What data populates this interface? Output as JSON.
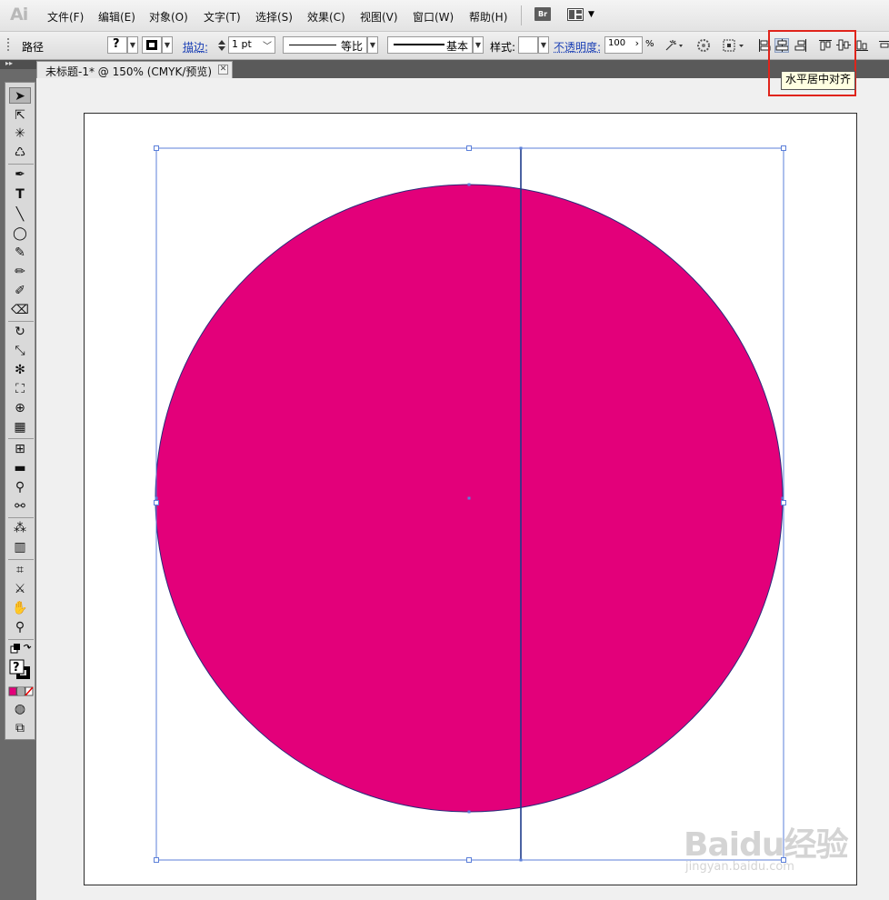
{
  "app": {
    "logo_text": "Ai"
  },
  "menu": {
    "items": [
      "文件(F)",
      "编辑(E)",
      "对象(O)",
      "文字(T)",
      "选择(S)",
      "效果(C)",
      "视图(V)",
      "窗口(W)",
      "帮助(H)"
    ],
    "bridge_label": "Br"
  },
  "controlbar": {
    "selection_label": "路径",
    "fill_value": "?",
    "stroke_label": "描边:",
    "stroke_weight": "1 pt",
    "variable_width_label": "等比",
    "brush_label": "基本",
    "style_label": "样式:",
    "opacity_label": "不透明度:",
    "opacity_value": "100",
    "opacity_unit": "%"
  },
  "document": {
    "tab_title": "未标题-1* @ 150% (CMYK/预览)",
    "close_glyph": "✕"
  },
  "tooltip": {
    "text": "水平居中对齐"
  },
  "artwork": {
    "circle_fill": "#e3007a",
    "selection_color": "#5b7fd9"
  },
  "watermark": {
    "main": "Baidu经验",
    "url": "jingyan.baidu.com"
  }
}
